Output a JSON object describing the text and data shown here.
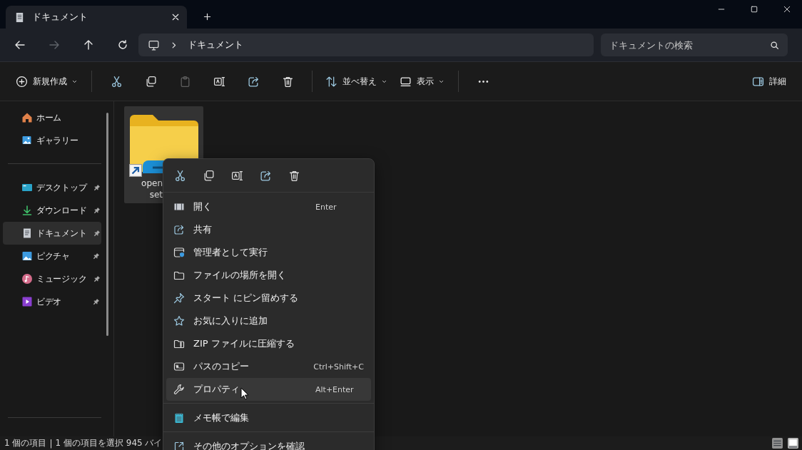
{
  "tab": {
    "title": "ドキュメント"
  },
  "nav_buttons": [
    {
      "kind": "back",
      "disabled": false
    },
    {
      "kind": "forward",
      "disabled": true
    },
    {
      "kind": "up",
      "disabled": false
    },
    {
      "kind": "refresh",
      "disabled": false
    }
  ],
  "address": {
    "path": "ドキュメント"
  },
  "search": {
    "placeholder": "ドキュメントの検索"
  },
  "toolbar": [
    {
      "kind": "new",
      "label": "新規作成",
      "dropdown": true,
      "disabled": false
    },
    {
      "kind": "separator"
    },
    {
      "kind": "cut",
      "disabled": false
    },
    {
      "kind": "copy",
      "disabled": false
    },
    {
      "kind": "paste",
      "disabled": true
    },
    {
      "kind": "rename",
      "disabled": false
    },
    {
      "kind": "share",
      "disabled": false
    },
    {
      "kind": "delete",
      "disabled": false
    },
    {
      "kind": "separator"
    },
    {
      "kind": "sort",
      "label": "並べ替え",
      "dropdown": true,
      "disabled": false
    },
    {
      "kind": "view",
      "label": "表示",
      "dropdown": true,
      "disabled": false
    },
    {
      "kind": "separator"
    },
    {
      "kind": "more",
      "disabled": false
    }
  ],
  "details_button": {
    "label": "詳細"
  },
  "sidebar": {
    "groups": [
      [
        {
          "kind": "home",
          "label": "ホーム",
          "pinned": false,
          "selected": false
        },
        {
          "kind": "gallery",
          "label": "ギャラリー",
          "pinned": false,
          "selected": false
        }
      ],
      [
        {
          "kind": "desktop",
          "label": "デスクトップ",
          "pinned": true,
          "selected": false
        },
        {
          "kind": "download",
          "label": "ダウンロード",
          "pinned": true,
          "selected": false
        },
        {
          "kind": "document",
          "label": "ドキュメント",
          "pinned": true,
          "selected": true
        },
        {
          "kind": "pictures",
          "label": "ピクチャ",
          "pinned": true,
          "selected": false
        },
        {
          "kind": "music",
          "label": "ミュージック",
          "pinned": true,
          "selected": false
        },
        {
          "kind": "video",
          "label": "ビデオ",
          "pinned": true,
          "selected": false
        }
      ]
    ]
  },
  "files": [
    {
      "name_lines": [
        "open",
        "set"
      ],
      "shortcut": true,
      "selected": true
    }
  ],
  "context_menu": {
    "quick_actions": [
      {
        "kind": "cut"
      },
      {
        "kind": "copy"
      },
      {
        "kind": "rename"
      },
      {
        "kind": "share"
      },
      {
        "kind": "delete"
      }
    ],
    "items": [
      {
        "kind": "open",
        "label": "開く",
        "shortcut": "Enter",
        "hovered": false
      },
      {
        "kind": "share",
        "label": "共有",
        "hovered": false
      },
      {
        "kind": "admin",
        "label": "管理者として実行",
        "hovered": false
      },
      {
        "kind": "location",
        "label": "ファイルの場所を開く",
        "hovered": false
      },
      {
        "kind": "pin",
        "label": "スタート にピン留めする",
        "hovered": false
      },
      {
        "kind": "favorite",
        "label": "お気に入りに追加",
        "hovered": false
      },
      {
        "kind": "zip",
        "label": "ZIP ファイルに圧縮する",
        "hovered": false
      },
      {
        "kind": "copypath",
        "label": "パスのコピー",
        "shortcut": "Ctrl+Shift+C",
        "hovered": false
      },
      {
        "kind": "properties",
        "label": "プロパティ",
        "shortcut": "Alt+Enter",
        "hovered": true
      },
      {
        "kind": "separator"
      },
      {
        "kind": "notepad",
        "label": "メモ帳で編集",
        "hovered": false
      },
      {
        "kind": "separator"
      },
      {
        "kind": "more",
        "label": "その他のオプションを確認",
        "hovered": false
      }
    ]
  },
  "status_bar": {
    "item_count": "1 個の項目",
    "divider": "|",
    "selection": "1 個の項目を選択 945 バイ"
  },
  "view_modes": [
    {
      "kind": "details",
      "selected": false
    },
    {
      "kind": "tiles",
      "selected": true
    }
  ]
}
